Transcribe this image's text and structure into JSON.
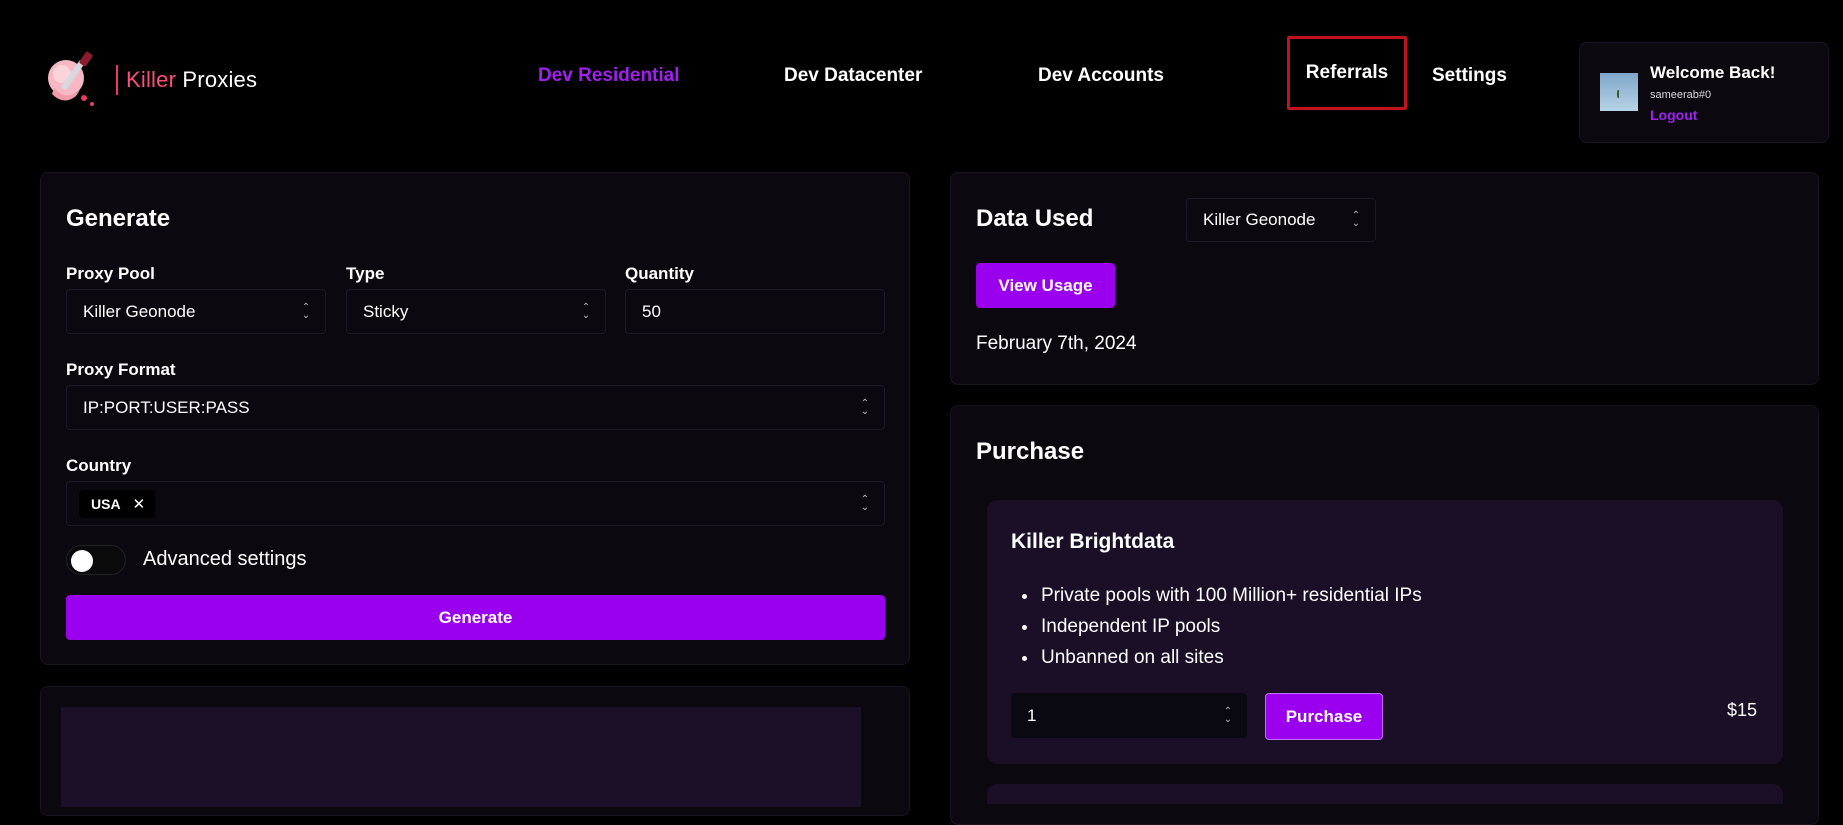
{
  "brand": {
    "name_part1": "Killer",
    "name_part2": "Proxies"
  },
  "nav": {
    "items": [
      "Dev Residential",
      "Dev Datacenter",
      "Dev Accounts",
      "Referrals",
      "Settings"
    ],
    "active": "Dev Residential"
  },
  "user": {
    "welcome": "Welcome Back!",
    "username": "sameerab#0",
    "logout": "Logout"
  },
  "generate": {
    "title": "Generate",
    "proxy_pool": {
      "label": "Proxy Pool",
      "value": "Killer Geonode"
    },
    "type": {
      "label": "Type",
      "value": "Sticky"
    },
    "quantity": {
      "label": "Quantity",
      "value": "50"
    },
    "proxy_format": {
      "label": "Proxy Format",
      "value": "IP:PORT:USER:PASS"
    },
    "country": {
      "label": "Country",
      "chips": [
        "USA"
      ]
    },
    "advanced": {
      "label": "Advanced settings",
      "enabled": false
    },
    "button": "Generate"
  },
  "data_used": {
    "title": "Data Used",
    "pool": "Killer Geonode",
    "button": "View Usage",
    "date": "February 7th, 2024"
  },
  "purchase": {
    "title": "Purchase",
    "products": [
      {
        "name": "Killer Brightdata",
        "features": [
          "Private pools with 100 Million+ residential IPs",
          "Independent IP pools",
          "Unbanned on all sites"
        ],
        "quantity": "1",
        "button": "Purchase",
        "price": "$15"
      }
    ]
  },
  "colors": {
    "accent": "#9b00ee",
    "nav_active": "#a020f0",
    "brand_pink": "#ff4d7a",
    "highlight_border": "#c0141c"
  },
  "icons": [
    "knife-logo-icon",
    "chevron-updown-icon",
    "close-icon",
    "avatar-image"
  ]
}
